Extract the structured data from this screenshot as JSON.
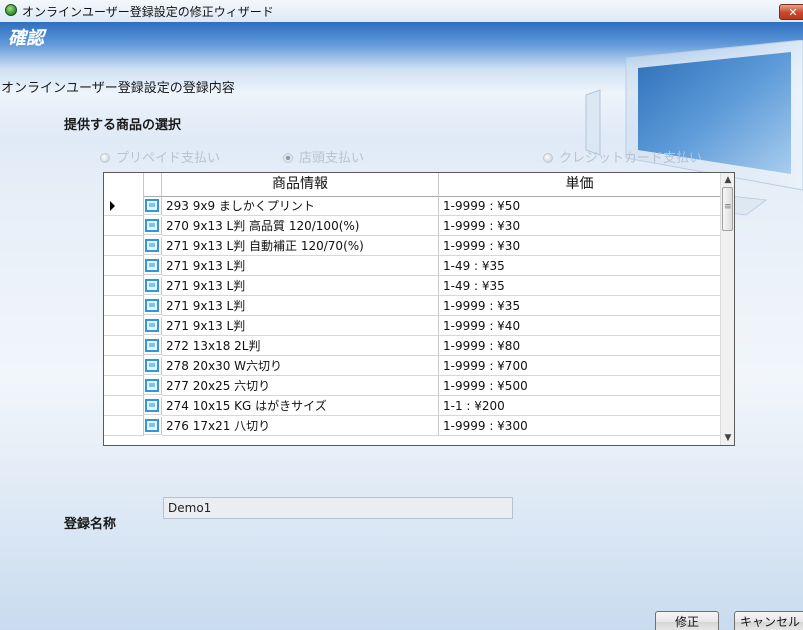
{
  "window": {
    "title": "オンラインユーザー登録設定の修正ウィザード",
    "close_label": "✕"
  },
  "page": {
    "title": "確認",
    "subtitle": "オンラインユーザー登録設定の登録内容"
  },
  "product_selection": {
    "heading": "提供する商品の選択",
    "payment_options": [
      {
        "label": "プリペイド支払い",
        "selected": false
      },
      {
        "label": "店頭支払い",
        "selected": true
      },
      {
        "label": "クレジットカード支払い",
        "selected": false
      }
    ]
  },
  "grid": {
    "columns": [
      "商品情報",
      "単価"
    ],
    "rows": [
      {
        "info": "293  9x9 ましかくプリント",
        "price": "1-9999 : ¥50",
        "current": true
      },
      {
        "info": "270  9x13 L判 高品質 120/100(%)",
        "price": "1-9999 : ¥30",
        "current": false
      },
      {
        "info": "271  9x13 L判 自動補正 120/70(%)",
        "price": "1-9999 : ¥30",
        "current": false
      },
      {
        "info": "271  9x13 L判",
        "price": "1-49 : ¥35",
        "current": false
      },
      {
        "info": "271  9x13 L判",
        "price": "1-49 : ¥35",
        "current": false
      },
      {
        "info": "271  9x13 L判",
        "price": "1-9999 : ¥35",
        "current": false
      },
      {
        "info": "271  9x13 L判",
        "price": "1-9999 : ¥40",
        "current": false
      },
      {
        "info": "272  13x18 2L判",
        "price": "1-9999 : ¥80",
        "current": false
      },
      {
        "info": "278  20x30 W六切り",
        "price": "1-9999 : ¥700",
        "current": false
      },
      {
        "info": "277  20x25 六切り",
        "price": "1-9999 : ¥500",
        "current": false
      },
      {
        "info": "274  10x15 KG はがきサイズ",
        "price": "1-1 : ¥200",
        "current": false
      },
      {
        "info": "276  17x21 八切り",
        "price": "1-9999 : ¥300",
        "current": false
      }
    ]
  },
  "registration": {
    "label": "登録名称",
    "value": "Demo1"
  },
  "buttons": {
    "modify": "修正",
    "cancel": "キャンセル"
  },
  "icons": {
    "app": "app-globe-icon",
    "row": "photo-print-icon",
    "current_row": "row-pointer-icon"
  }
}
